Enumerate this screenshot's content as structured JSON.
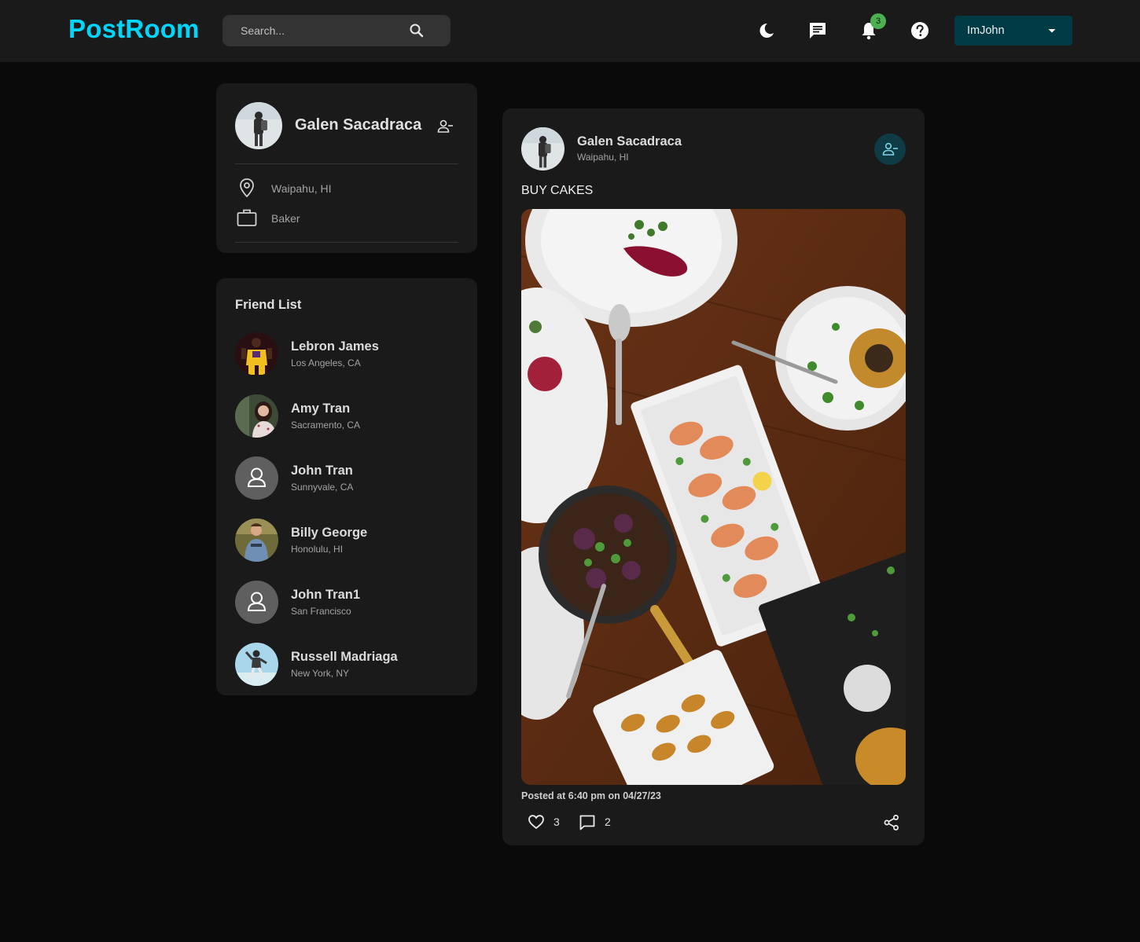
{
  "navbar": {
    "brand": "PostRoom",
    "search_placeholder": "Search...",
    "notification_count": "3",
    "user_menu_label": "ImJohn",
    "colors": {
      "brand": "#00d5fa",
      "badge": "#4caf50",
      "user_menu_bg": "#003a44"
    },
    "icons": [
      "search-icon",
      "dark-mode-icon",
      "messages-icon",
      "notifications-icon",
      "help-icon",
      "caret-down-icon"
    ]
  },
  "profile": {
    "name": "Galen Sacadraca",
    "location": "Waipahu, HI",
    "occupation": "Baker"
  },
  "friends": {
    "title": "Friend List",
    "items": [
      {
        "name": "Lebron James",
        "location": "Los Angeles, CA",
        "avatar": "photo"
      },
      {
        "name": "Amy Tran",
        "location": "Sacramento, CA",
        "avatar": "photo"
      },
      {
        "name": "John Tran",
        "location": "Sunnyvale, CA",
        "avatar": "default-person-icon"
      },
      {
        "name": "Billy George",
        "location": "Honolulu, HI",
        "avatar": "photo"
      },
      {
        "name": "John Tran1",
        "location": "San Francisco",
        "avatar": "default-person-icon"
      },
      {
        "name": "Russell Madriaga",
        "location": "New York, NY",
        "avatar": "photo"
      }
    ]
  },
  "post": {
    "author": "Galen Sacadraca",
    "location": "Waipahu, HI",
    "text": "BUY CAKES",
    "timestamp": "Posted at 6:40 pm on 04/27/23",
    "likes": "3",
    "comments": "2",
    "colors": {
      "remove_friend_btn_bg": "#0e3b46",
      "remove_friend_icon": "#7fd3e6"
    }
  }
}
